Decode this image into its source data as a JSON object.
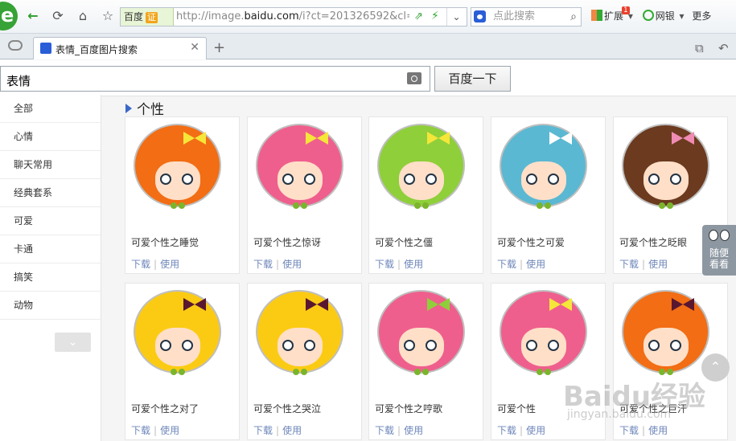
{
  "toolbar": {
    "back_icon": "arrow-left-icon",
    "forward_icon": "arrow-right-icon",
    "refresh_icon": "refresh-icon",
    "home_icon": "home-icon",
    "star_icon": "star-icon",
    "badge_label": "百度",
    "badge_tag": "证",
    "url_prefix": "http://image.",
    "url_domain": "baidu.com",
    "url_rest": "/i?ct=201326592&cl=",
    "search_placeholder": "点此搜索",
    "ext_label": "扩展",
    "ext_badge": "1",
    "bank_label": "网银",
    "more_label": "更多"
  },
  "tabs": [
    {
      "title": "表情_百度图片搜索"
    }
  ],
  "search": {
    "keyword": "表情",
    "button": "百度一下"
  },
  "sidebar": {
    "items": [
      {
        "label": "全部"
      },
      {
        "label": "心情"
      },
      {
        "label": "聊天常用"
      },
      {
        "label": "经典套系"
      },
      {
        "label": "可爱"
      },
      {
        "label": "卡通"
      },
      {
        "label": "搞笑"
      },
      {
        "label": "动物"
      }
    ]
  },
  "section": {
    "title": "个性"
  },
  "cards": [
    {
      "name": "可爱个性之睡觉",
      "download": "下载",
      "use": "使用",
      "hair": "#f26d13",
      "bow": "#f5e63a"
    },
    {
      "name": "可爱个性之惊讶",
      "download": "下载",
      "use": "使用",
      "hair": "#ef5f8d",
      "bow": "#f5e63a"
    },
    {
      "name": "可爱个性之僵",
      "download": "下载",
      "use": "使用",
      "hair": "#8fcf3a",
      "bow": "#f5e63a"
    },
    {
      "name": "可爱个性之可爱",
      "download": "下载",
      "use": "使用",
      "hair": "#5ab8d2",
      "bow": "#ffffff"
    },
    {
      "name": "可爱个性之眨眼",
      "download": "下载",
      "use": "使用",
      "hair": "#6b3a1f",
      "bow": "#f08bb3"
    },
    {
      "name": "可爱个性之对了",
      "download": "下载",
      "use": "使用",
      "hair": "#fbcb14",
      "bow": "#5a1730"
    },
    {
      "name": "可爱个性之哭泣",
      "download": "下载",
      "use": "使用",
      "hair": "#fbcb14",
      "bow": "#5a1730"
    },
    {
      "name": "可爱个性之哼歌",
      "download": "下载",
      "use": "使用",
      "hair": "#ef5f8d",
      "bow": "#8fcf3a"
    },
    {
      "name": "可爱个性",
      "download": "下载",
      "use": "使用",
      "hair": "#ef5f8d",
      "bow": "#f5e63a"
    },
    {
      "name": "可爱个性之巨汗",
      "download": "下载",
      "use": "使用",
      "hair": "#f26d13",
      "bow": "#5a1730"
    }
  ],
  "floating": {
    "random_line1": "随便",
    "random_line2": "看看"
  },
  "watermark": {
    "brand": "Baidu经验",
    "url": "jingyan.baidu.com"
  }
}
